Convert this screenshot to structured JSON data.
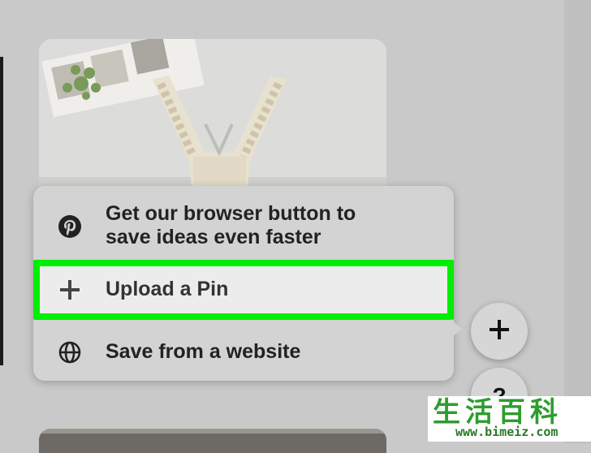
{
  "popup": {
    "items": [
      {
        "label_line1": "Get our browser button to",
        "label_line2": "save ideas even faster",
        "icon": "pinterest-icon"
      },
      {
        "label": "Upload a Pin",
        "icon": "plus-icon",
        "highlighted": true
      },
      {
        "label": "Save from a website",
        "icon": "globe-icon"
      }
    ]
  },
  "fab": {
    "help_label": "?"
  },
  "watermark": {
    "chars": [
      "生",
      "活",
      "百",
      "科"
    ],
    "url": "www.bimeiz.com"
  },
  "colors": {
    "highlight": "#00ee00",
    "popup_bg": "#d3d3d3",
    "page_bg": "#c9c9c9"
  }
}
